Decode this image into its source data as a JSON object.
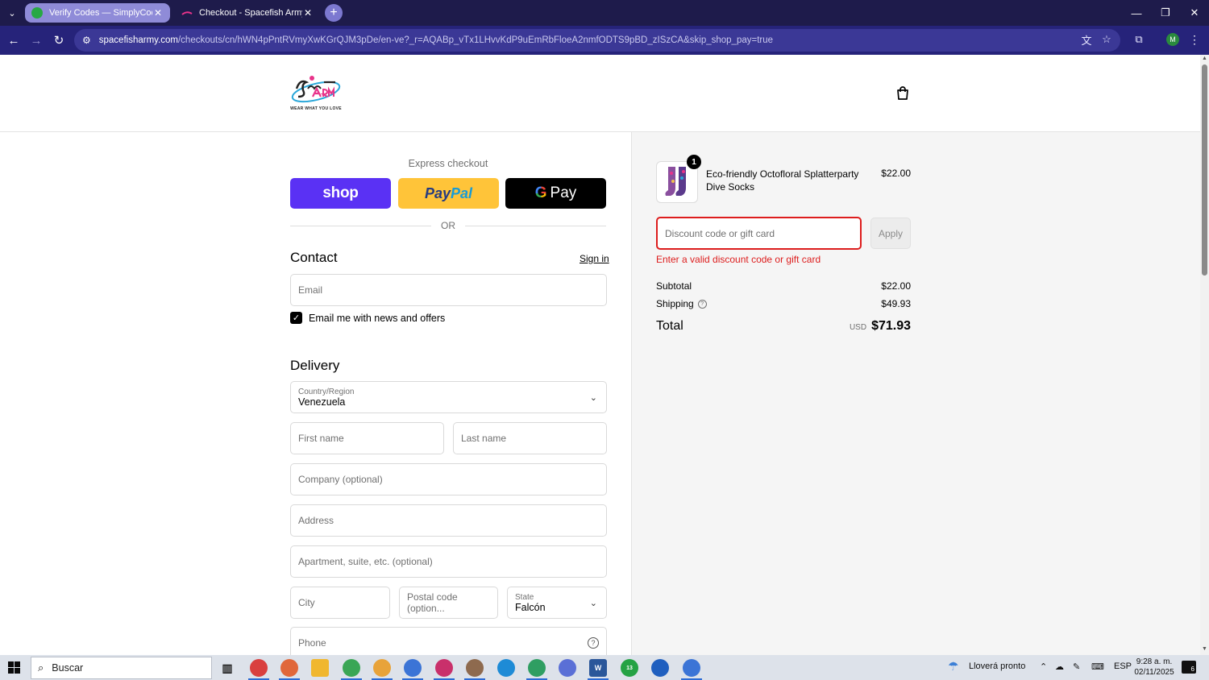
{
  "browser": {
    "tabs": [
      {
        "title": "Verify Codes — SimplyCodes",
        "active": false
      },
      {
        "title": "Checkout - Spacefish Army",
        "active": true
      }
    ],
    "url_domain": "spacefisharmy.com",
    "url_path": "/checkouts/cn/hWN4pPntRVmyXwKGrQJM3pDe/en-ve?_r=AQABp_vTx1LHvvKdP9uEmRbFloeA2nmfODTS9pBD_zISzCA&skip_shop_pay=true",
    "profile_initial": "M"
  },
  "store": {
    "logo_text": "WEAR WHAT YOU LOVE"
  },
  "express": {
    "title": "Express checkout",
    "shop_label": "shop",
    "paypal_label_1": "Pay",
    "paypal_label_2": "Pal",
    "gpay_g": "G",
    "gpay_label": "Pay",
    "or": "OR"
  },
  "contact": {
    "heading": "Contact",
    "sign_in": "Sign in",
    "email_placeholder": "Email",
    "newsletter_label": "Email me with news and offers",
    "newsletter_checked": true
  },
  "delivery": {
    "heading": "Delivery",
    "country_label": "Country/Region",
    "country_value": "Venezuela",
    "first_name": "First name",
    "last_name": "Last name",
    "company": "Company (optional)",
    "address": "Address",
    "apartment": "Apartment, suite, etc. (optional)",
    "city": "City",
    "postal": "Postal code (option...",
    "state_label": "State",
    "state_value": "Falcón",
    "phone": "Phone"
  },
  "summary": {
    "quantity": "1",
    "product_name": "Eco-friendly Octofloral Splatterparty Dive Socks",
    "product_price": "$22.00",
    "discount_placeholder": "Discount code or gift card",
    "apply": "Apply",
    "error": "Enter a valid discount code or gift card",
    "subtotal_label": "Subtotal",
    "subtotal_value": "$22.00",
    "shipping_label": "Shipping",
    "shipping_value": "$49.93",
    "total_label": "Total",
    "currency": "USD",
    "total_value": "$71.93"
  },
  "taskbar": {
    "search": "Buscar",
    "weather": "Lloverá pronto",
    "lang": "ESP",
    "time": "9:28 a. m.",
    "date": "02/11/2025",
    "notifications": "6",
    "whatsapp_badge": "13"
  },
  "colors": {
    "shop_purple": "#5a31f4",
    "paypal_yellow": "#ffc439",
    "error_red": "#dd1d1d"
  }
}
